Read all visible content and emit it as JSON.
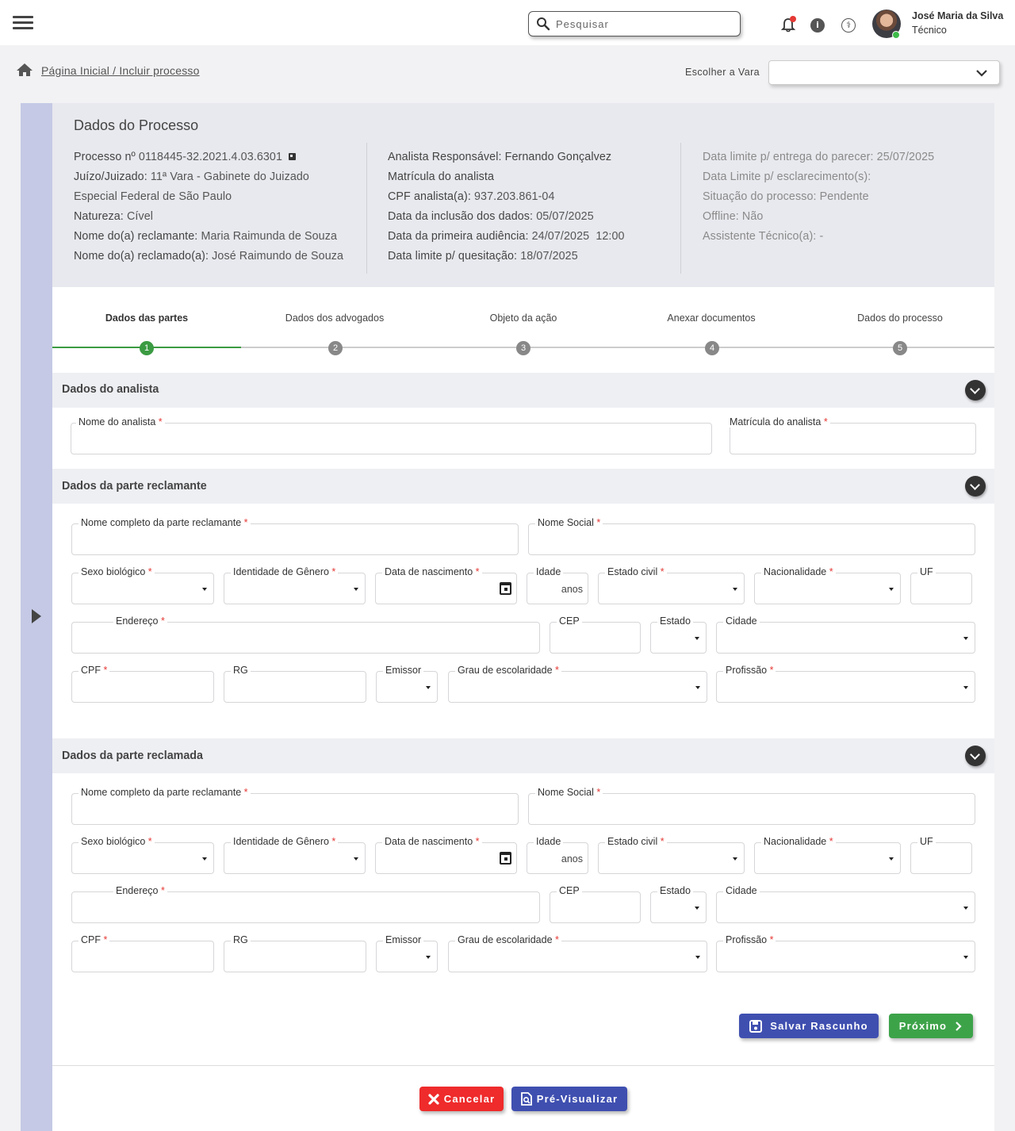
{
  "header": {
    "search_placeholder": "Pesquisar",
    "user_name": "José Maria da Silva",
    "user_role": "Técnico"
  },
  "breadcrumb": {
    "text": "Página Inicial / Incluir processo"
  },
  "vara": {
    "label": "Escolher a Vara",
    "value": ""
  },
  "processo": {
    "title": "Dados do Processo",
    "col1": [
      {
        "label": "Processo nº",
        "value": "0118445-32.2021.4.03.6301"
      },
      {
        "label": "Juízo/Juizado:",
        "value": "11ª Vara - Gabinete do Juizado"
      },
      {
        "label": "",
        "value": "Especial Federal de São Paulo"
      },
      {
        "label": "Natureza:",
        "value": "Cível"
      },
      {
        "label": "Nome do(a) reclamante:",
        "value": "Maria Raimunda de Souza"
      },
      {
        "label": "Nome do(a) reclamado(a):",
        "value": "José Raimundo de Souza"
      }
    ],
    "col2": [
      {
        "label": "Analista Responsável:",
        "value": "Fernando Gonçalvez"
      },
      {
        "label": "Matrícula do analista",
        "value": ""
      },
      {
        "label": "CPF analista(a):",
        "value": "937.203.861-04"
      },
      {
        "label": "Data da inclusão dos dados:",
        "value": "05/07/2025"
      },
      {
        "label": "Data da primeira audiência:",
        "value": "24/07/2025  12:00"
      },
      {
        "label": "Data limite p/ quesitação:",
        "value": "18/07/2025"
      }
    ],
    "col3": [
      {
        "label": "Data limite p/ entrega do parecer:",
        "value": "25/07/2025"
      },
      {
        "label": "Data Limite p/ esclarecimento(s):",
        "value": ""
      },
      {
        "label": "Situação do processo:",
        "value": "Pendente"
      },
      {
        "label": "Offline:",
        "value": "Não"
      },
      {
        "label": "Assistente Técnico(a):",
        "value": "-"
      }
    ]
  },
  "steps": [
    {
      "label": "Dados das partes",
      "num": "1"
    },
    {
      "label": "Dados dos advogados",
      "num": "2"
    },
    {
      "label": "Objeto da ação",
      "num": "3"
    },
    {
      "label": "Anexar documentos",
      "num": "4"
    },
    {
      "label": "Dados do processo",
      "num": "5"
    }
  ],
  "sections": {
    "analista": {
      "title": "Dados do analista",
      "nome": "Nome do analista",
      "matricula": "Matrícula do analista"
    },
    "reclamante": {
      "title": "Dados da parte reclamante"
    },
    "reclamada": {
      "title": "Dados da parte reclamada"
    }
  },
  "party_fields": {
    "nome": "Nome completo da parte reclamante",
    "nome_social": "Nome Social",
    "sexo": "Sexo biológico",
    "identidade": "Identidade de Gênero",
    "nascimento": "Data de nascimento",
    "idade": "Idade",
    "anos": "anos",
    "estado_civil": "Estado civil",
    "nacionalidade": "Nacionalidade",
    "uf": "UF",
    "endereco": "Endereço",
    "cep": "CEP",
    "estado": "Estado",
    "cidade": "Cidade",
    "cpf": "CPF",
    "rg": "RG",
    "emissor": "Emissor",
    "escolaridade": "Grau de escolaridade",
    "profissao": "Profissão"
  },
  "buttons": {
    "save": "Salvar Rascunho",
    "next": "Próximo",
    "cancel": "Cancelar",
    "preview": "Pré-Visualizar"
  },
  "colors": {
    "primary": "#3f4fb0",
    "success": "#3da349",
    "danger": "#ef2b2b",
    "required": "#e53935",
    "rail": "#c5c9e5"
  }
}
